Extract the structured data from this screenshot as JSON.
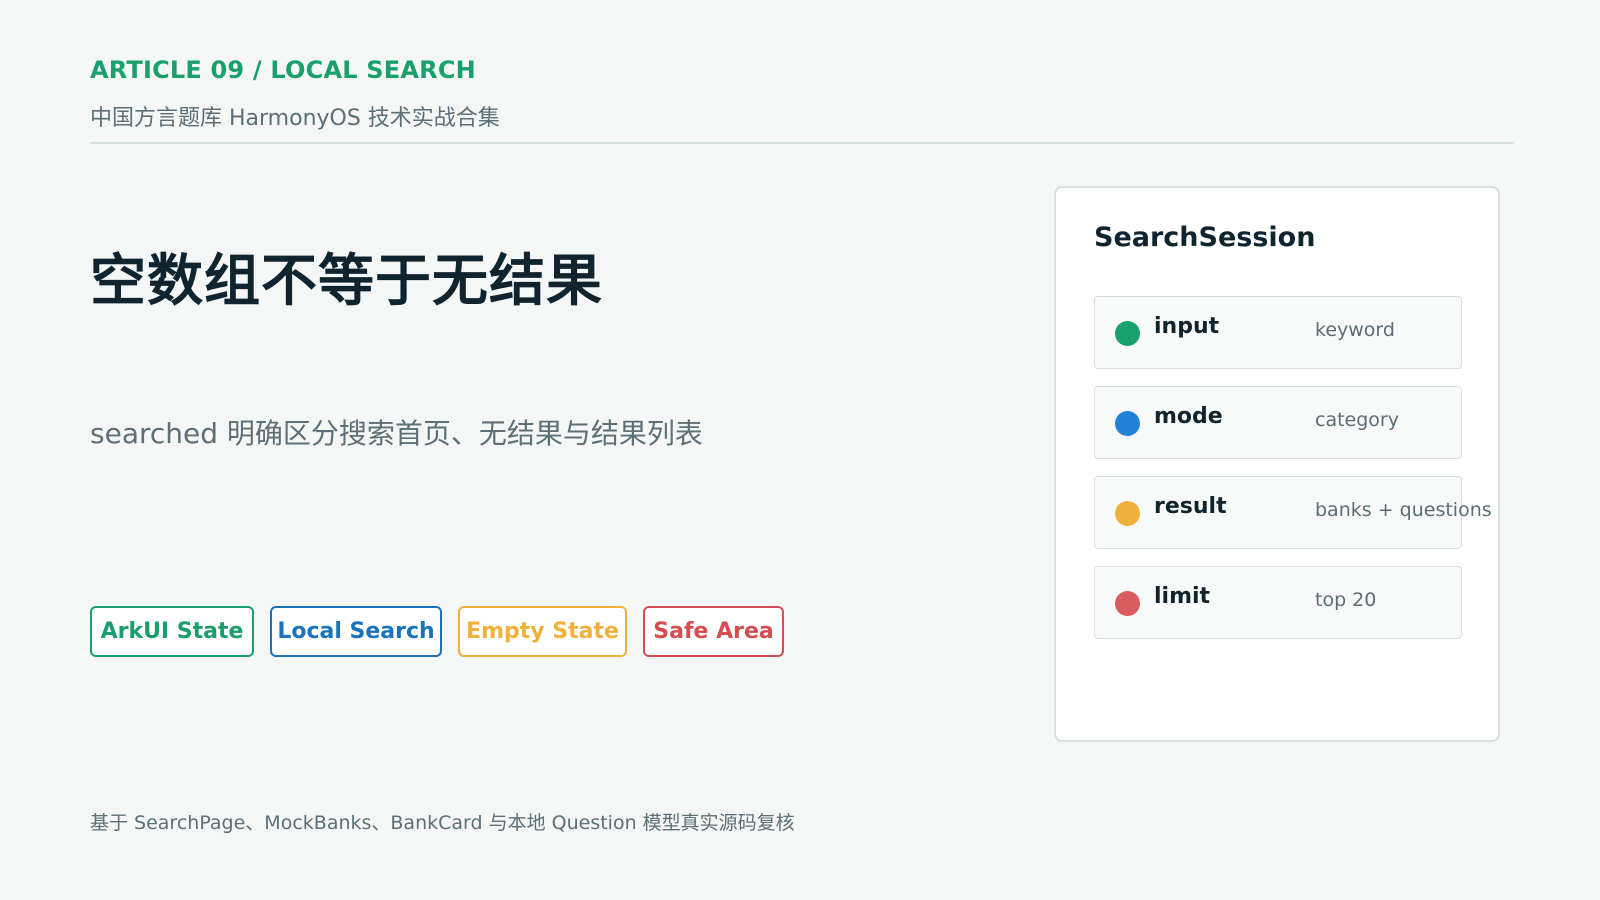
{
  "header": {
    "kicker": "ARTICLE 09 / LOCAL SEARCH",
    "subtitle": "中国方言题库 HarmonyOS 技术实战合集"
  },
  "main": {
    "headline": "空数组不等于无结果",
    "lead": "searched 明确区分搜索首页、无结果与结果列表",
    "tags": [
      {
        "label": "ArkUI State",
        "color": "#1a9e6d"
      },
      {
        "label": "Local Search",
        "color": "#1a73bd"
      },
      {
        "label": "Empty State",
        "color": "#f0b13b"
      },
      {
        "label": "Safe Area",
        "color": "#d64d51"
      }
    ]
  },
  "card": {
    "title": "SearchSession",
    "rows": [
      {
        "key": "input",
        "value": "keyword",
        "dot_color": "#1aa06d"
      },
      {
        "key": "mode",
        "value": "category",
        "dot_color": "#2281d8"
      },
      {
        "key": "result",
        "value": "banks + questions",
        "dot_color": "#f0b13b"
      },
      {
        "key": "limit",
        "value": "top 20",
        "dot_color": "#d95c5e"
      }
    ]
  },
  "footer": {
    "text": "基于 SearchPage、MockBanks、BankCard 与本地 Question 模型真实源码复核"
  }
}
